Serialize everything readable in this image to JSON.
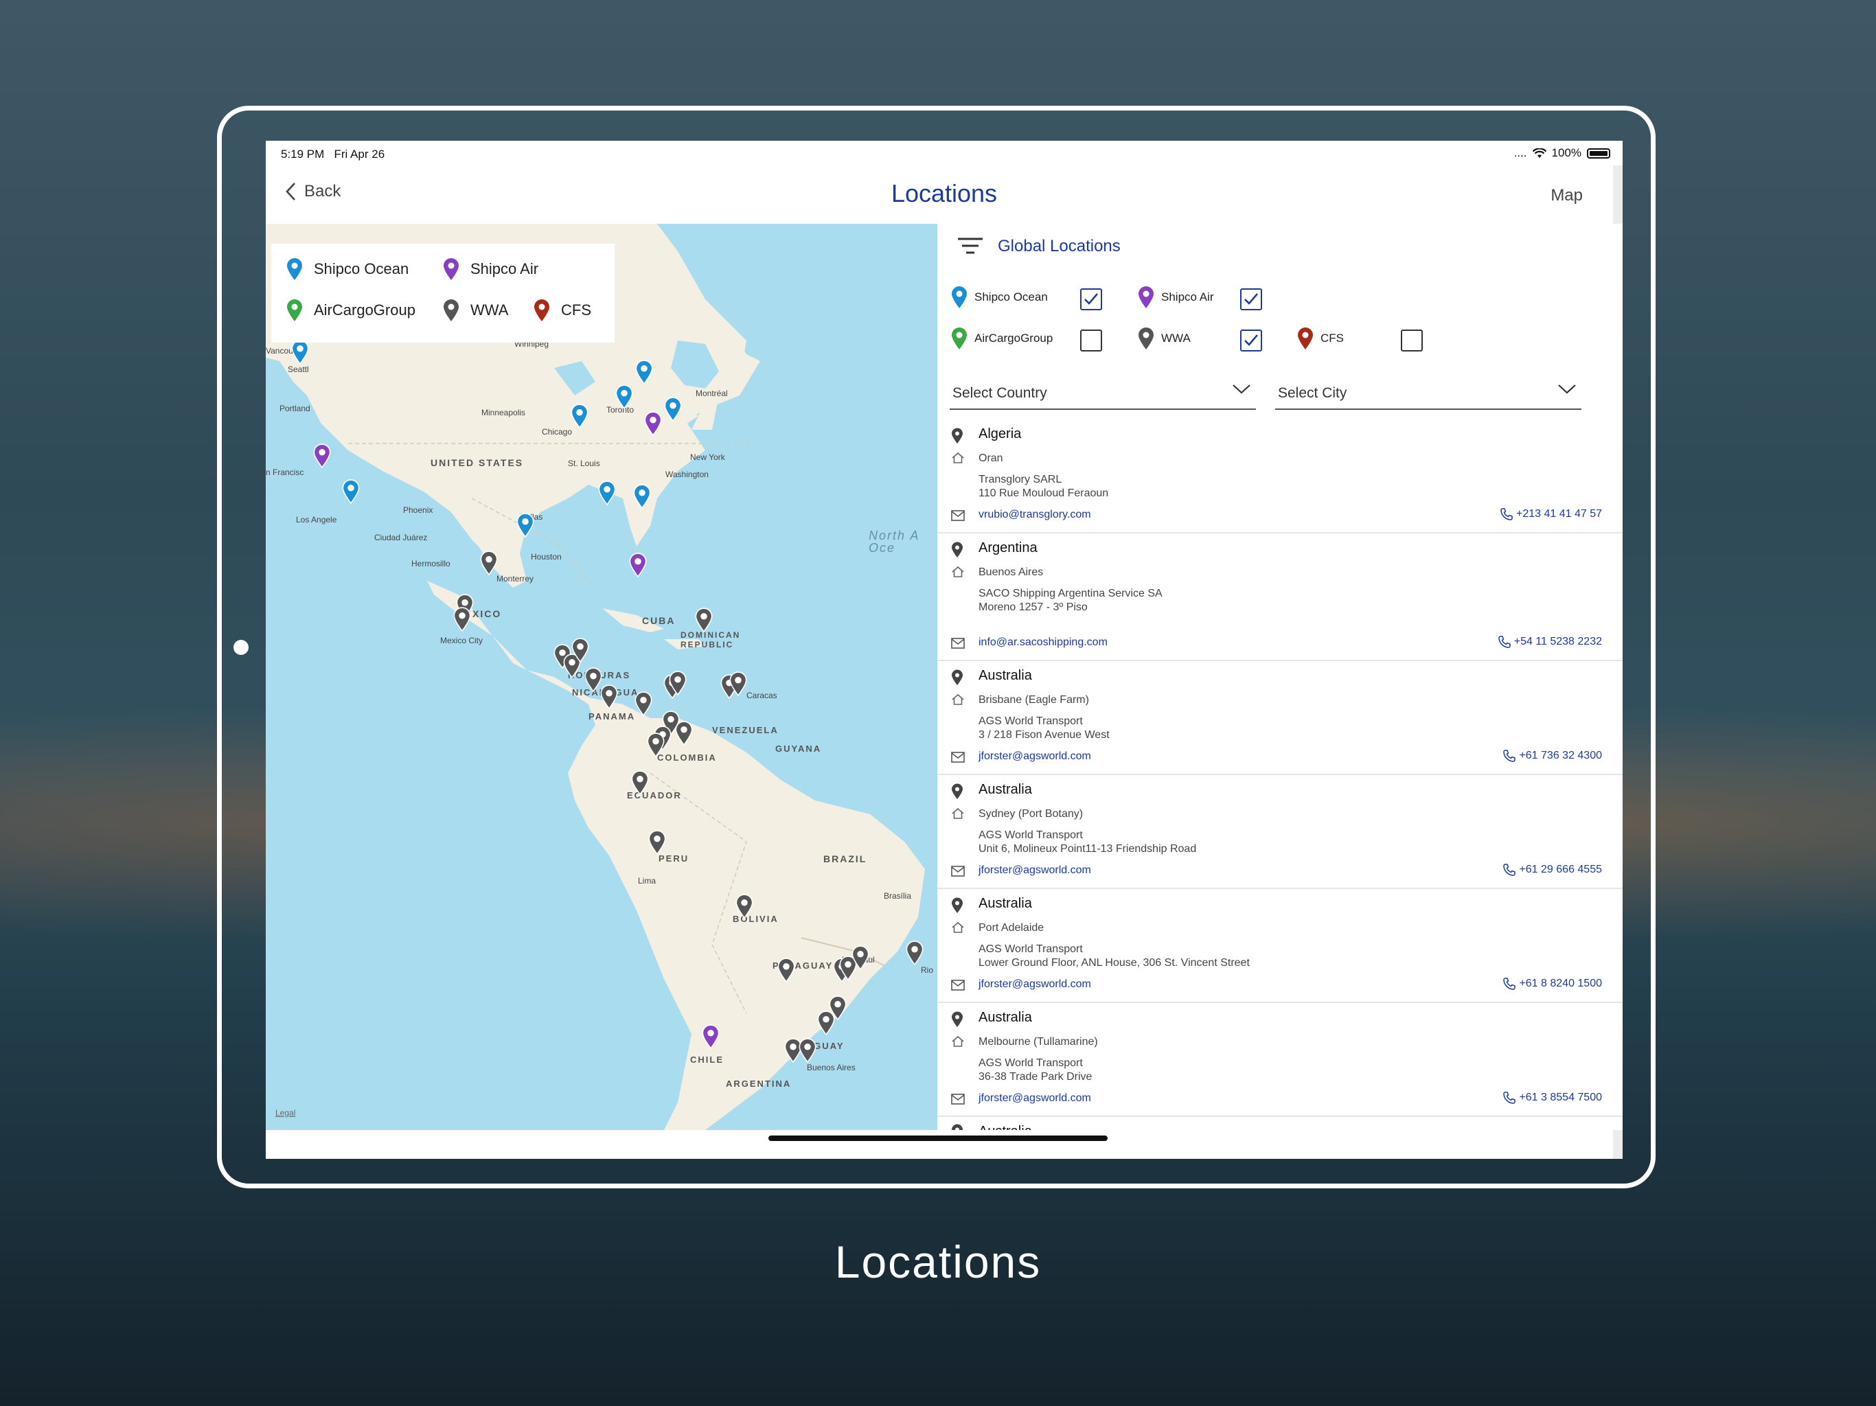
{
  "caption": "Locations",
  "status": {
    "time": "5:19 PM",
    "date": "Fri Apr 26",
    "battery": "100%"
  },
  "nav": {
    "back": "Back",
    "title": "Locations",
    "right": "Map"
  },
  "legend": [
    {
      "name": "Shipco Ocean",
      "color": "#1a8fd6"
    },
    {
      "name": "Shipco Air",
      "color": "#8a3fc2"
    },
    {
      "name": "AirCargoGroup",
      "color": "#3aa845"
    },
    {
      "name": "WWA",
      "color": "#555555"
    },
    {
      "name": "CFS",
      "color": "#a72b16"
    }
  ],
  "map_labels": {
    "us": "UNITED STATES",
    "mexico": "MEXICO",
    "cuba": "CUBA",
    "dominican": "DOMINICAN REPUBLIC",
    "honduras": "HONDURAS",
    "nicaragua": "NICARAGUA",
    "panama": "PANAMA",
    "venezuela": "VENEZUELA",
    "guyana": "GUYANA",
    "colombia": "COLOMBIA",
    "ecuador": "ECUADOR",
    "peru": "PERU",
    "brazil": "BRAZIL",
    "bolivia": "BOLIVIA",
    "paraguay": "PARAGUAY",
    "chile": "CHILE",
    "argentina": "ARGENTINA",
    "uruguay": "URUGUAY",
    "ocean": "North A\nOce"
  },
  "map_cities": {
    "vancouver": "Vancouve",
    "seattle": "Seattl",
    "portland": "Portland",
    "winnipeg": "Winnipeg",
    "minneapolis": "Minneapolis",
    "chicago": "Chicago",
    "toronto": "Toronto",
    "montreal": "Montréal",
    "newyork": "New York",
    "washington": "Washington",
    "stlouis": "St. Louis",
    "sanfrancisco": "n Francisc",
    "losangeles": "Los Angele",
    "phoenix": "Phoenix",
    "dallas": "Dallas",
    "ciudadjuarez": "Ciudad Juárez",
    "hermosillo": "Hermosillo",
    "houston": "Houston",
    "monterrey": "Monterrey",
    "mexicocity": "Mexico City",
    "caracas": "Caracas",
    "lima": "Lima",
    "brasilia": "Brasília",
    "saopaulo": "São Paul",
    "rio": "Rio",
    "buenosaires": "Buenos Aires"
  },
  "legal": "Legal",
  "filter": {
    "title": "Global Locations",
    "items": [
      {
        "label": "Shipco Ocean",
        "checked": true,
        "color": "#1a8fd6"
      },
      {
        "label": "Shipco Air",
        "checked": true,
        "color": "#8a3fc2"
      },
      {
        "label": "AirCargoGroup",
        "checked": false,
        "color": "#3aa845"
      },
      {
        "label": "WWA",
        "checked": true,
        "color": "#555555"
      },
      {
        "label": "CFS",
        "checked": false,
        "color": "#a72b16"
      }
    ],
    "country_placeholder": "Select Country",
    "city_placeholder": "Select City"
  },
  "locations": [
    {
      "country": "Algeria",
      "city": "Oran",
      "company": "Transglory SARL",
      "address": "110 Rue Mouloud Feraoun",
      "email": "vrubio@transglory.com",
      "phone": "+213 41 41 47 57"
    },
    {
      "country": "Argentina",
      "city": "Buenos Aires",
      "company": "SACO Shipping Argentina Service SA",
      "address": "Moreno 1257 - 3º Piso",
      "email": "info@ar.sacoshipping.com",
      "phone": "+54 11 5238 2232"
    },
    {
      "country": "Australia",
      "city": "Brisbane (Eagle Farm)",
      "company": "AGS World Transport",
      "address": "3 / 218 Fison Avenue West",
      "email": "jforster@agsworld.com",
      "phone": "+61 736 32 4300"
    },
    {
      "country": "Australia",
      "city": "Sydney (Port Botany)",
      "company": "AGS World Transport",
      "address": "Unit 6, Molineux Point11-13 Friendship Road",
      "email": "jforster@agsworld.com",
      "phone": "+61 29 666 4555"
    },
    {
      "country": "Australia",
      "city": "Port Adelaide",
      "company": "AGS World Transport",
      "address": "Lower Ground Floor, ANL House, 306 St. Vincent Street",
      "email": "jforster@agsworld.com",
      "phone": "+61 8 8240 1500"
    },
    {
      "country": "Australia",
      "city": "Melbourne (Tullamarine)",
      "company": "AGS World Transport",
      "address": "36-38 Trade Park Drive",
      "email": "jforster@agsworld.com",
      "phone": "+61 3 8554 7500"
    }
  ],
  "peek_country": "Australia"
}
